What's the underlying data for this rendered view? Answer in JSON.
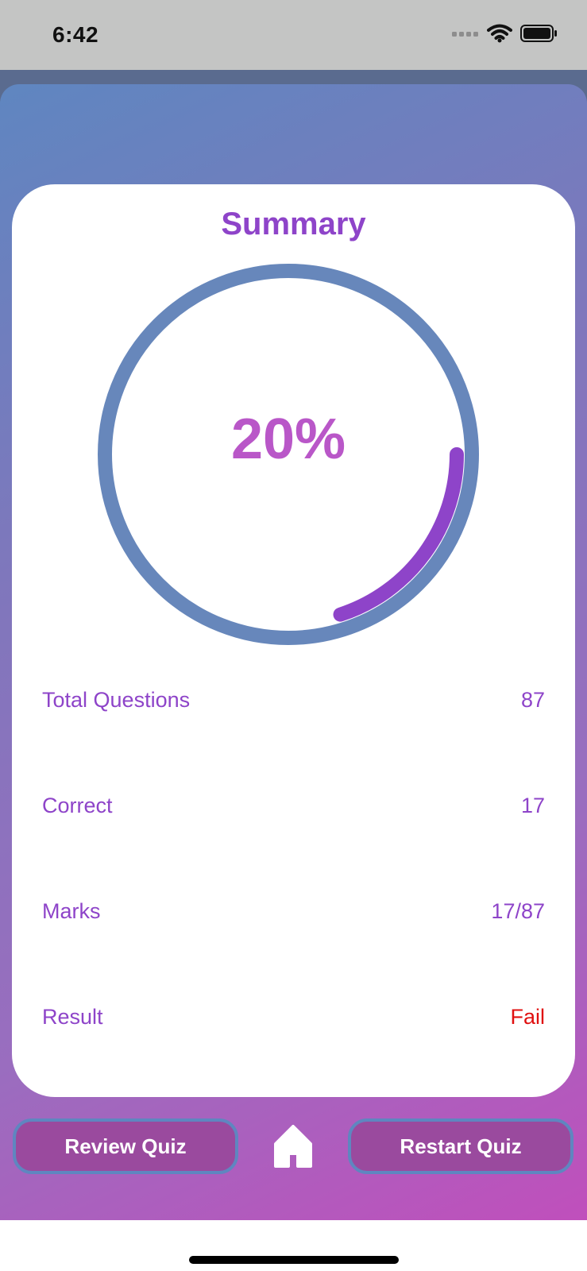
{
  "status_bar": {
    "time": "6:42"
  },
  "summary": {
    "title": "Summary",
    "percent_label": "20%",
    "progress_fraction": 0.2
  },
  "stats": [
    {
      "label": "Total Questions",
      "value": "87"
    },
    {
      "label": "Correct",
      "value": "17"
    },
    {
      "label": "Marks",
      "value": "17/87"
    },
    {
      "label": "Result",
      "value": "Fail"
    }
  ],
  "actions": {
    "review_label": "Review Quiz",
    "restart_label": "Restart Quiz",
    "home_icon": "home-icon"
  },
  "colors": {
    "accent_purple": "#8e44c9",
    "ring_track": "#6787bb",
    "ring_progress": "#8e44c9",
    "fail_red": "#e01010",
    "button_fill": "#9a4a9e",
    "button_border": "#5f86c0"
  }
}
